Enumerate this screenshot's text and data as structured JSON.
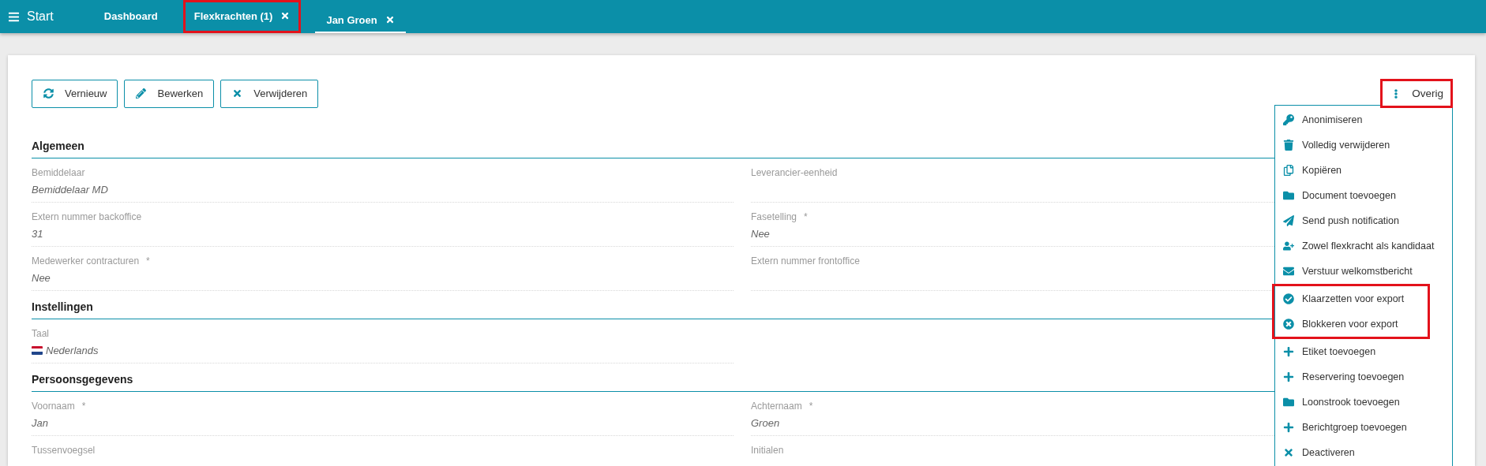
{
  "topbar": {
    "menu_label": "Start",
    "tabs": [
      {
        "label": "Dashboard",
        "closable": false,
        "selected": false,
        "highlighted": false
      },
      {
        "label": "Flexkrachten (1)",
        "closable": true,
        "selected": false,
        "highlighted": true
      },
      {
        "label": "Jan Groen",
        "closable": true,
        "selected": true,
        "highlighted": false
      }
    ]
  },
  "toolbar": {
    "buttons": [
      "Vernieuw",
      "Bewerken",
      "Verwijderen"
    ],
    "more": {
      "label": "Overig",
      "highlighted": true
    }
  },
  "menu": [
    {
      "label": "Anonimiseren",
      "highlighted": false
    },
    {
      "label": "Volledig verwijderen",
      "highlighted": false
    },
    {
      "label": "Kopiëren",
      "highlighted": false
    },
    {
      "label": "Document toevoegen",
      "highlighted": false
    },
    {
      "label": "Send push notification",
      "highlighted": false
    },
    {
      "label": "Zowel flexkracht als kandidaat",
      "highlighted": false
    },
    {
      "label": "Verstuur welkomstbericht",
      "highlighted": false
    },
    {
      "label": "Klaarzetten voor export",
      "highlighted": true
    },
    {
      "label": "Blokkeren voor export",
      "highlighted": true
    },
    {
      "label": "Etiket toevoegen",
      "highlighted": false
    },
    {
      "label": "Reservering toevoegen",
      "highlighted": false
    },
    {
      "label": "Loonstrook toevoegen",
      "highlighted": false
    },
    {
      "label": "Berichtgroep toevoegen",
      "highlighted": false
    },
    {
      "label": "Deactiveren",
      "highlighted": false
    }
  ],
  "sections": [
    {
      "title": "Algemeen",
      "fields": [
        {
          "label": "Bemiddelaar",
          "value": "Bemiddelaar MD",
          "kind": "text"
        },
        {
          "label": "Leverancier-eenheid",
          "kind": "text"
        },
        {
          "label": "Extern nummer backoffice",
          "value": "31",
          "kind": "text"
        },
        {
          "label": "Fasetelling",
          "required_mark": "*",
          "value": "Nee",
          "kind": "text"
        },
        {
          "label": "Medewerker contracturen",
          "required_mark": "*",
          "value": "Nee",
          "kind": "text"
        },
        {
          "label": "Extern nummer frontoffice",
          "kind": "text"
        }
      ]
    },
    {
      "title": "Instellingen",
      "fields": [
        {
          "label": "Taal",
          "value": "Nederlands",
          "kind": "language"
        }
      ]
    },
    {
      "title": "Persoonsgegevens",
      "fields": [
        {
          "label": "Voornaam",
          "required_mark": "*",
          "value": "Jan",
          "kind": "text"
        },
        {
          "label": "Achternaam",
          "required_mark": "*",
          "value": "Groen",
          "kind": "text"
        },
        {
          "label": "Tussenvoegsel",
          "kind": "text"
        },
        {
          "label": "Initialen",
          "kind": "text"
        }
      ]
    }
  ]
}
